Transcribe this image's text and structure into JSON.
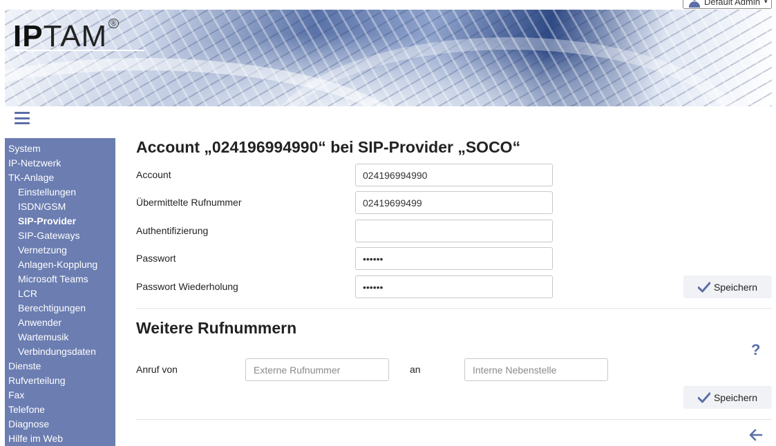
{
  "user_menu": {
    "label": "Default Admin",
    "icon": "user-icon"
  },
  "logo": {
    "ip": "IP",
    "tam": "TAM",
    "reg": "®"
  },
  "sidebar": {
    "items": [
      {
        "label": "System",
        "level": 0
      },
      {
        "label": "IP-Netzwerk",
        "level": 0
      },
      {
        "label": "TK-Anlage",
        "level": 0
      },
      {
        "label": "Einstellungen",
        "level": 1
      },
      {
        "label": "ISDN/GSM",
        "level": 1
      },
      {
        "label": "SIP-Provider",
        "level": 1,
        "active": true
      },
      {
        "label": "SIP-Gateways",
        "level": 1
      },
      {
        "label": "Vernetzung",
        "level": 1
      },
      {
        "label": "Anlagen-Kopplung",
        "level": 1
      },
      {
        "label": "Microsoft Teams",
        "level": 1
      },
      {
        "label": "LCR",
        "level": 1
      },
      {
        "label": "Berechtigungen",
        "level": 1
      },
      {
        "label": "Anwender",
        "level": 1
      },
      {
        "label": "Wartemusik",
        "level": 1
      },
      {
        "label": "Verbindungsdaten",
        "level": 1
      },
      {
        "label": "Dienste",
        "level": 0
      },
      {
        "label": "Rufverteilung",
        "level": 0
      },
      {
        "label": "Fax",
        "level": 0
      },
      {
        "label": "Telefone",
        "level": 0
      },
      {
        "label": "Diagnose",
        "level": 0
      },
      {
        "label": "Hilfe im Web",
        "level": 0
      }
    ]
  },
  "main": {
    "title": "Account „024196994990“ bei SIP-Provider „SOCO“",
    "fields": [
      {
        "label": "Account",
        "value": "024196994990"
      },
      {
        "label": "Übermittelte Rufnummer",
        "value": "02419699499"
      },
      {
        "label": "Authentifizierung",
        "value": ""
      },
      {
        "label": "Passwort",
        "value": "••••••"
      },
      {
        "label": "Passwort Wiederholung",
        "value": "••••••"
      }
    ],
    "save_label": "Speichern",
    "section2_title": "Weitere Rufnummern",
    "help_label": "?",
    "anruf_von_label": "Anruf von",
    "external_placeholder": "Externe Rufnummer",
    "an_label": "an",
    "internal_placeholder": "Interne Nebenstelle",
    "save2_label": "Speichern"
  },
  "colors": {
    "accent": "#5b6ea8",
    "sidebar_bg": "#6b7db1"
  }
}
